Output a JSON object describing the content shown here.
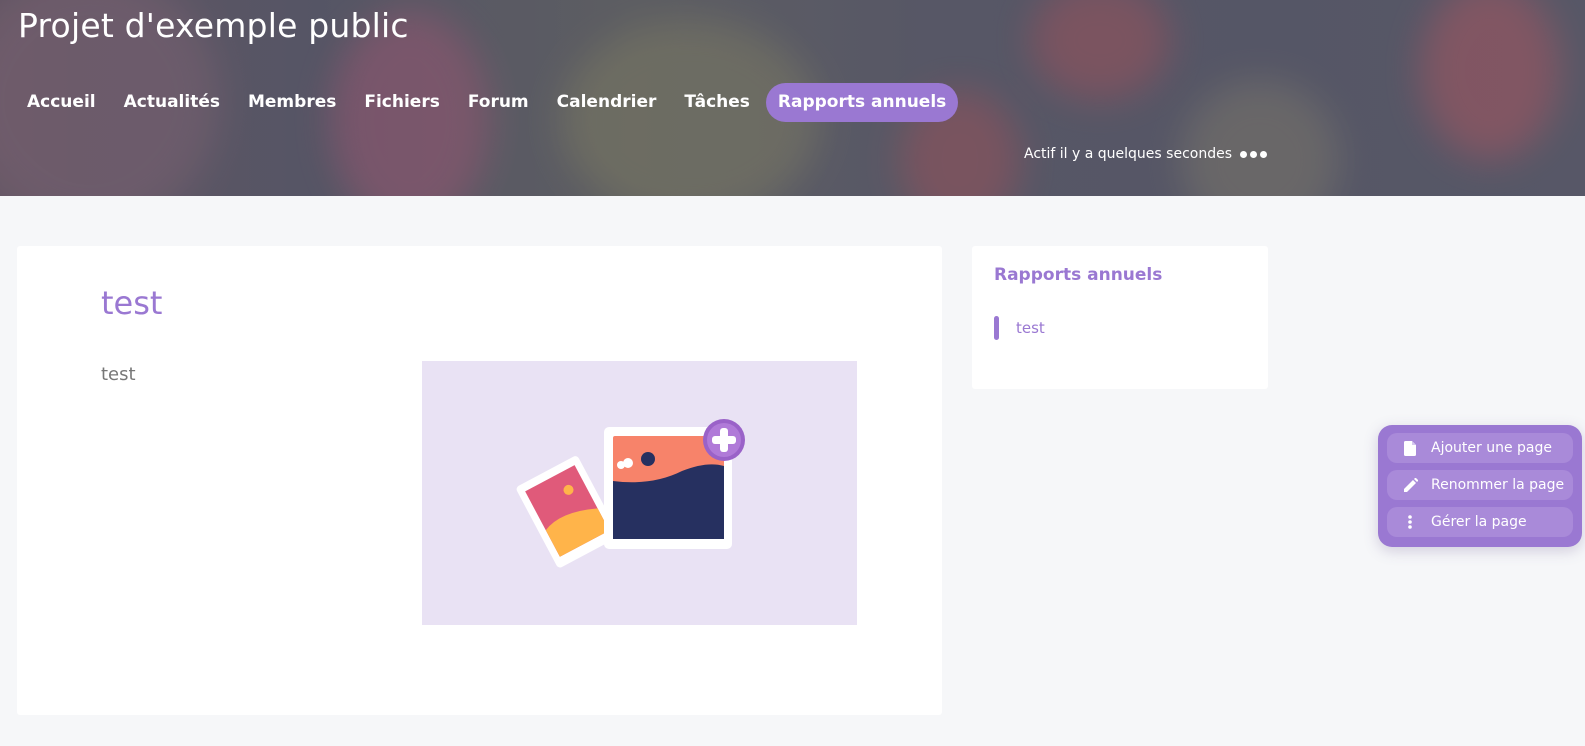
{
  "header": {
    "project_title": "Projet d'exemple public",
    "nav": [
      {
        "label": "Accueil",
        "active": false
      },
      {
        "label": "Actualités",
        "active": false
      },
      {
        "label": "Membres",
        "active": false
      },
      {
        "label": "Fichiers",
        "active": false
      },
      {
        "label": "Forum",
        "active": false
      },
      {
        "label": "Calendrier",
        "active": false
      },
      {
        "label": "Tâches",
        "active": false
      },
      {
        "label": "Rapports annuels",
        "active": true
      }
    ],
    "activity_status": "Actif il y a quelques secondes",
    "more_icon": "ellipsis-icon"
  },
  "main": {
    "heading": "test",
    "body_text": "test",
    "image_icon": "add-image-illustration"
  },
  "sidebar": {
    "title": "Rapports annuels",
    "items": [
      {
        "label": "test",
        "selected": true
      }
    ]
  },
  "page_actions": [
    {
      "label": "Ajouter une page",
      "icon": "file-icon"
    },
    {
      "label": "Renommer la page",
      "icon": "pencil-icon"
    },
    {
      "label": "Gérer la page",
      "icon": "vertical-dots-icon"
    }
  ],
  "colors": {
    "accent": "#9a78d2",
    "image_bg": "#e9e2f4",
    "page_bg": "#f6f7f9"
  }
}
